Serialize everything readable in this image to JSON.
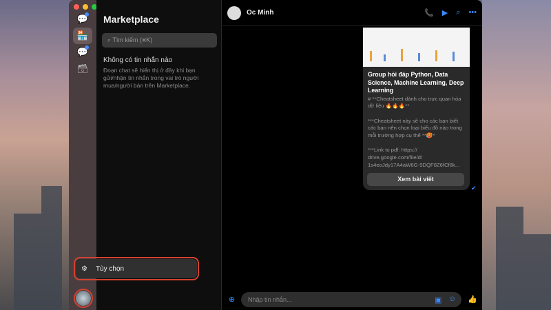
{
  "sidebar": {
    "title": "Marketplace",
    "search_placeholder": "Tìm kiếm (⌘K)",
    "empty_title": "Không có tin nhắn nào",
    "empty_desc": "Đoạn chat sẽ hiển thị ở đây khi bạn gửi/nhận tin nhắn trong vai trò người mua/người bán trên Marketplace.",
    "menu_item": "Tùy chọn"
  },
  "chat": {
    "contact_name": "Oc Minh",
    "input_placeholder": "Nhập tin nhắn...",
    "card": {
      "title": "Group hỏi đáp Python, Data Science, Machine Learning, Deep Learning",
      "body": "# **Cheatsheet dành cho trực quan hóa dữ liệu 🔥🔥🔥**\n\n***Cheatsheet này sẽ cho các bạn biết các bạn nên chọn loại biểu đồ nào trong mỗi trường hợp cụ thể **🥵*\n\n***Link to pdf: https://\ndrive.google.com/file/d/\n1s4eoJdy17A4aW6G-9DQF8Z6fCf8k...",
      "button": "Xem bài viết"
    }
  },
  "colors": {
    "accent": "#3a8bff",
    "highlight": "#d5412f"
  }
}
